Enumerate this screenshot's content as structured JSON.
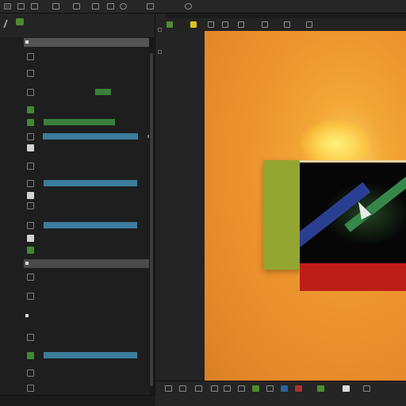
{
  "colors": {
    "accent_blue": "#3b7d9c",
    "accent_green": "#3b7f3b",
    "icon_green": "#4b8f2f",
    "viewport_orange": "#ec932e",
    "screen_red": "#bd1f18",
    "frame_green": "#93a631",
    "beam_blue": "#2b3f92",
    "beam_green": "#36874a"
  },
  "toolbar": {
    "title": "",
    "icons": [
      "app-logo-icon",
      "folder-icon",
      "edit-icon",
      "table-icon",
      "document-icon",
      "image-icon",
      "settings-icon",
      "camera-icon",
      "chain-icon",
      "circle-icon"
    ]
  },
  "left_panel": {
    "header_text": "",
    "rows": [
      {
        "label": "",
        "icon": "grid-icon",
        "extra": ""
      },
      {
        "label": "",
        "icon": "chart-icon",
        "extra": ""
      },
      {
        "label": "",
        "icon": "square-icon",
        "extra": ""
      },
      {
        "label": "",
        "icon": "layers-icon",
        "extra": ""
      },
      {
        "label": "",
        "icon": "sliders-icon",
        "extra": ""
      },
      {
        "label": "",
        "icon": "frame-icon",
        "extra": ""
      },
      {
        "label": "",
        "icon": "text-icon",
        "extra": ""
      },
      {
        "label": "",
        "icon": "grid-icon",
        "extra": ""
      },
      {
        "label": "",
        "icon": "layers-icon",
        "extra": ""
      },
      {
        "label": "",
        "icon": "paint-icon",
        "extra": ""
      },
      {
        "label": "",
        "icon": "document-icon",
        "extra": ""
      },
      {
        "label": "",
        "icon": "square-icon",
        "extra": ""
      },
      {
        "label": "",
        "icon": "link-icon",
        "extra": ""
      },
      {
        "label": "",
        "icon": "frame-icon",
        "extra": ""
      }
    ],
    "sections": [
      "",
      ""
    ],
    "footer_text": ""
  },
  "viewport": {
    "scene": "abstract-monitor"
  },
  "bottom_bar": {
    "icons": [
      "list-icon",
      "chart-icon",
      "document-icon",
      "frame-icon",
      "green-square-icon",
      "table-icon",
      "grid-icon",
      "camera-icon",
      "red-square-icon",
      "green-square-icon"
    ]
  }
}
